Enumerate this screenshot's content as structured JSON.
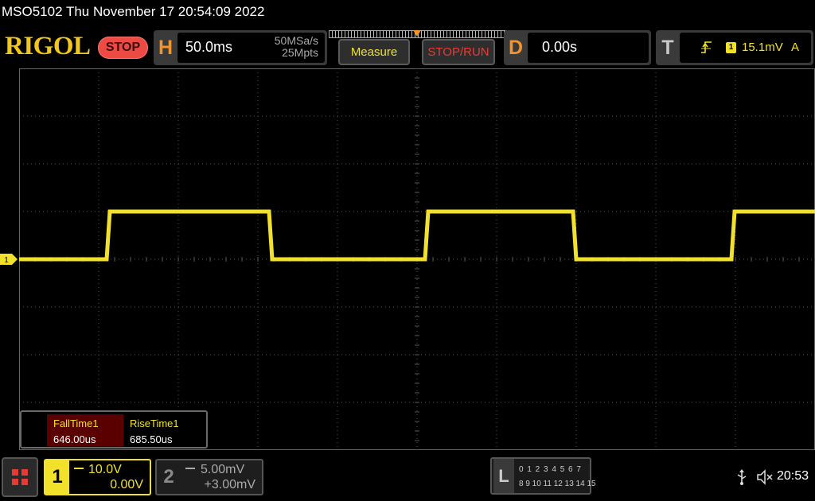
{
  "titlebar": {
    "text": "MSO5102  Thu November 17 20:54:09 2022"
  },
  "header": {
    "logo": "RIGOL",
    "run_state": "STOP",
    "horizontal": {
      "letter": "H",
      "timebase": "50.0ms",
      "sample_rate": "50MSa/s",
      "memory_depth": "25Mpts"
    },
    "measure_button": "Measure",
    "stoprun_button": "STOP/RUN",
    "delay": {
      "letter": "D",
      "value": "0.00s"
    },
    "trigger": {
      "letter": "T",
      "source": "1",
      "level": "15.1mV",
      "mode": "A",
      "slope_icon": "rising-edge-icon"
    }
  },
  "waveform": {
    "channel_marker": "1",
    "color": "#f2e12a",
    "low_level_div": 0,
    "high_level_div": 1.0,
    "rise_times_div": [
      1.12,
      5.12,
      8.97
    ],
    "fall_times_div": [
      3.16,
      6.98
    ]
  },
  "measurements": [
    {
      "name": "FallTime1",
      "value": "646.00us"
    },
    {
      "name": "RiseTime1",
      "value": "685.50us"
    }
  ],
  "channels": {
    "ch1": {
      "number": "1",
      "scale": "10.0V",
      "offset": "0.00V",
      "color": "#f2e12a"
    },
    "ch2": {
      "number": "2",
      "scale": "5.00mV",
      "offset": "+3.00mV"
    }
  },
  "logic": {
    "letter": "L",
    "row1": "0 1 2 3  4 5 6 7",
    "row2": "8  9 10 11  12 13 14 15"
  },
  "status": {
    "time": "20:53",
    "icons": [
      "usb-icon",
      "speaker-muted-icon"
    ]
  }
}
